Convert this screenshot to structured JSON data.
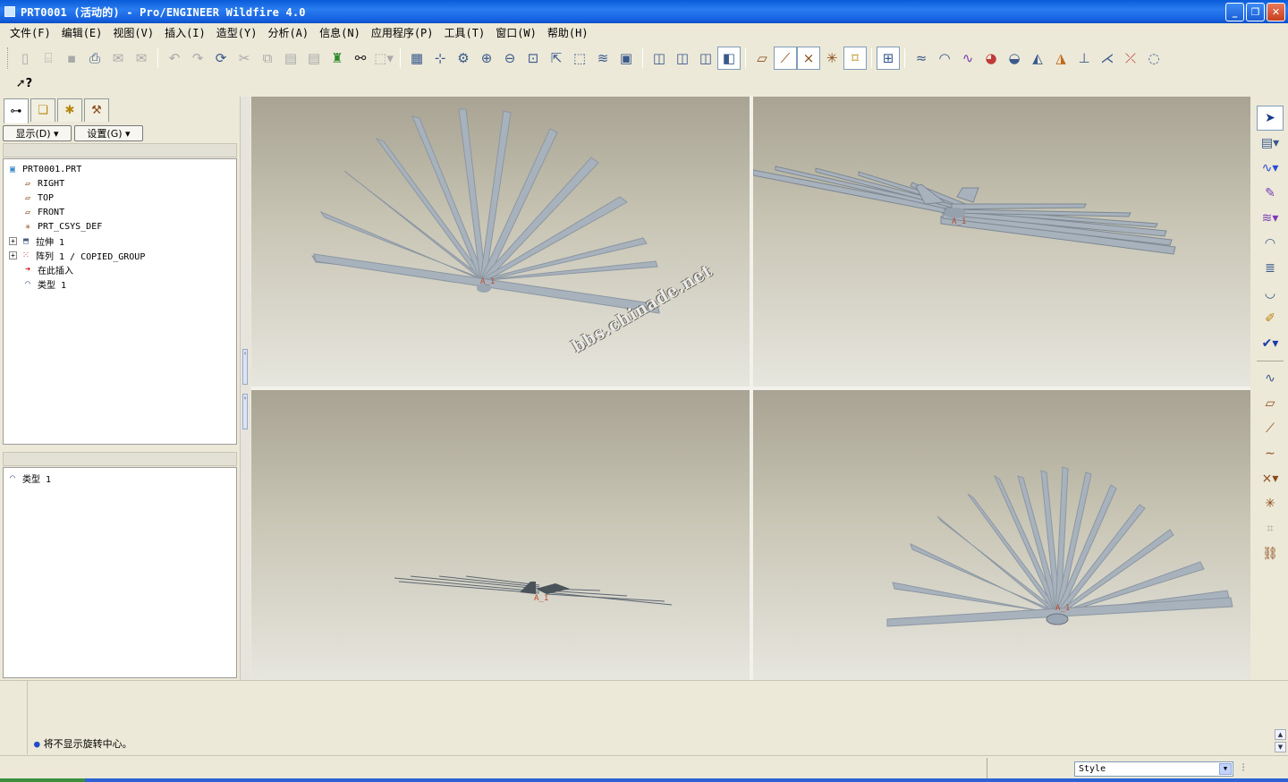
{
  "window": {
    "title": "PRT0001 (活动的) - Pro/ENGINEER Wildfire 4.0",
    "controls": [
      "_",
      "❐",
      "✕"
    ]
  },
  "menus": [
    "文件(F)",
    "编辑(E)",
    "视图(V)",
    "插入(I)",
    "造型(Y)",
    "分析(A)",
    "信息(N)",
    "应用程序(P)",
    "工具(T)",
    "窗口(W)",
    "帮助(H)"
  ],
  "toolbar": {
    "groups": [
      [
        "new-icon",
        "open-icon",
        "save-icon",
        "print-icon",
        "email-icon",
        "email-link-icon"
      ],
      [
        "undo-icon",
        "redo-icon",
        "regenerate-icon",
        "cut-icon",
        "copy-icon",
        "paste-icon",
        "paste-special-icon",
        "regen-manager-icon",
        "find-icon",
        "select-box-icon"
      ],
      [
        "redraw-icon",
        "spin-center-icon",
        "orient-icon",
        "zoom-in-icon",
        "zoom-out-icon",
        "refit-icon",
        "reorient-icon",
        "saved-views-icon",
        "layers-icon",
        "view-manager-icon"
      ],
      [
        "wireframe-icon",
        "hidden-line-icon",
        "no-hidden-icon",
        "shading-icon"
      ],
      [
        "datum-plane-display-icon",
        "datum-axis-display-icon",
        "point-display-icon",
        "csys-display-icon",
        "annotation-display-icon"
      ],
      [
        "multi-view-icon"
      ],
      [
        "surface-analysis-icon",
        "curvature-icon",
        "reflection-icon",
        "draft-icon",
        "slope-icon",
        "section-icon",
        "offset-icon",
        "deviation-icon",
        "dihedral-icon",
        "delete-analysis-icon",
        "hide-analysis-icon"
      ]
    ],
    "context_help": "?"
  },
  "left_panel": {
    "tabs": [
      "model-tree-icon",
      "folder-browser-icon",
      "favorites-icon",
      "connections-icon"
    ],
    "show_button": "显示(D)",
    "settings_button": "设置(G)",
    "tree": [
      {
        "label": "PRT0001.PRT",
        "icon": "part-icon",
        "level": 0,
        "expand": ""
      },
      {
        "label": "RIGHT",
        "icon": "datum-plane-icon",
        "level": 1,
        "expand": ""
      },
      {
        "label": "TOP",
        "icon": "datum-plane-icon",
        "level": 1,
        "expand": ""
      },
      {
        "label": "FRONT",
        "icon": "datum-plane-icon",
        "level": 1,
        "expand": ""
      },
      {
        "label": "PRT_CSYS_DEF",
        "icon": "csys-icon",
        "level": 1,
        "expand": ""
      },
      {
        "label": "拉伸 1",
        "icon": "extrude-icon",
        "level": 1,
        "expand": "+"
      },
      {
        "label": "阵列 1 / COPIED_GROUP",
        "icon": "pattern-icon",
        "level": 1,
        "expand": "+"
      },
      {
        "label": "在此插入",
        "icon": "insert-here-icon",
        "level": 1,
        "expand": ""
      },
      {
        "label": "类型 1",
        "icon": "style-feature-icon",
        "level": 1,
        "expand": ""
      }
    ],
    "lower_list": [
      {
        "label": "类型 1",
        "icon": "style-feature-icon"
      }
    ]
  },
  "viewport": {
    "csys_label": "A_1",
    "watermark": "bbs.chinade.net"
  },
  "right_toolbar": [
    "select-icon",
    "sketch-plane-icon",
    "curve-icon",
    "curve-edit-icon",
    "surface-icon",
    "surface-connect-icon",
    "surface-trim-icon",
    "surface-edit-icon",
    "style-surface-icon",
    "accept-icon",
    "curve-analysis-icon",
    "datum-plane-tool-icon",
    "datum-axis-tool-icon",
    "datum-curve-tool-icon",
    "datum-point-tool-icon",
    "csys-tool-icon",
    "analysis-tool-icon",
    "publish-icon"
  ],
  "messages": [
    "将不显示旋转中心。"
  ],
  "status": {
    "filter_value": "Style"
  }
}
